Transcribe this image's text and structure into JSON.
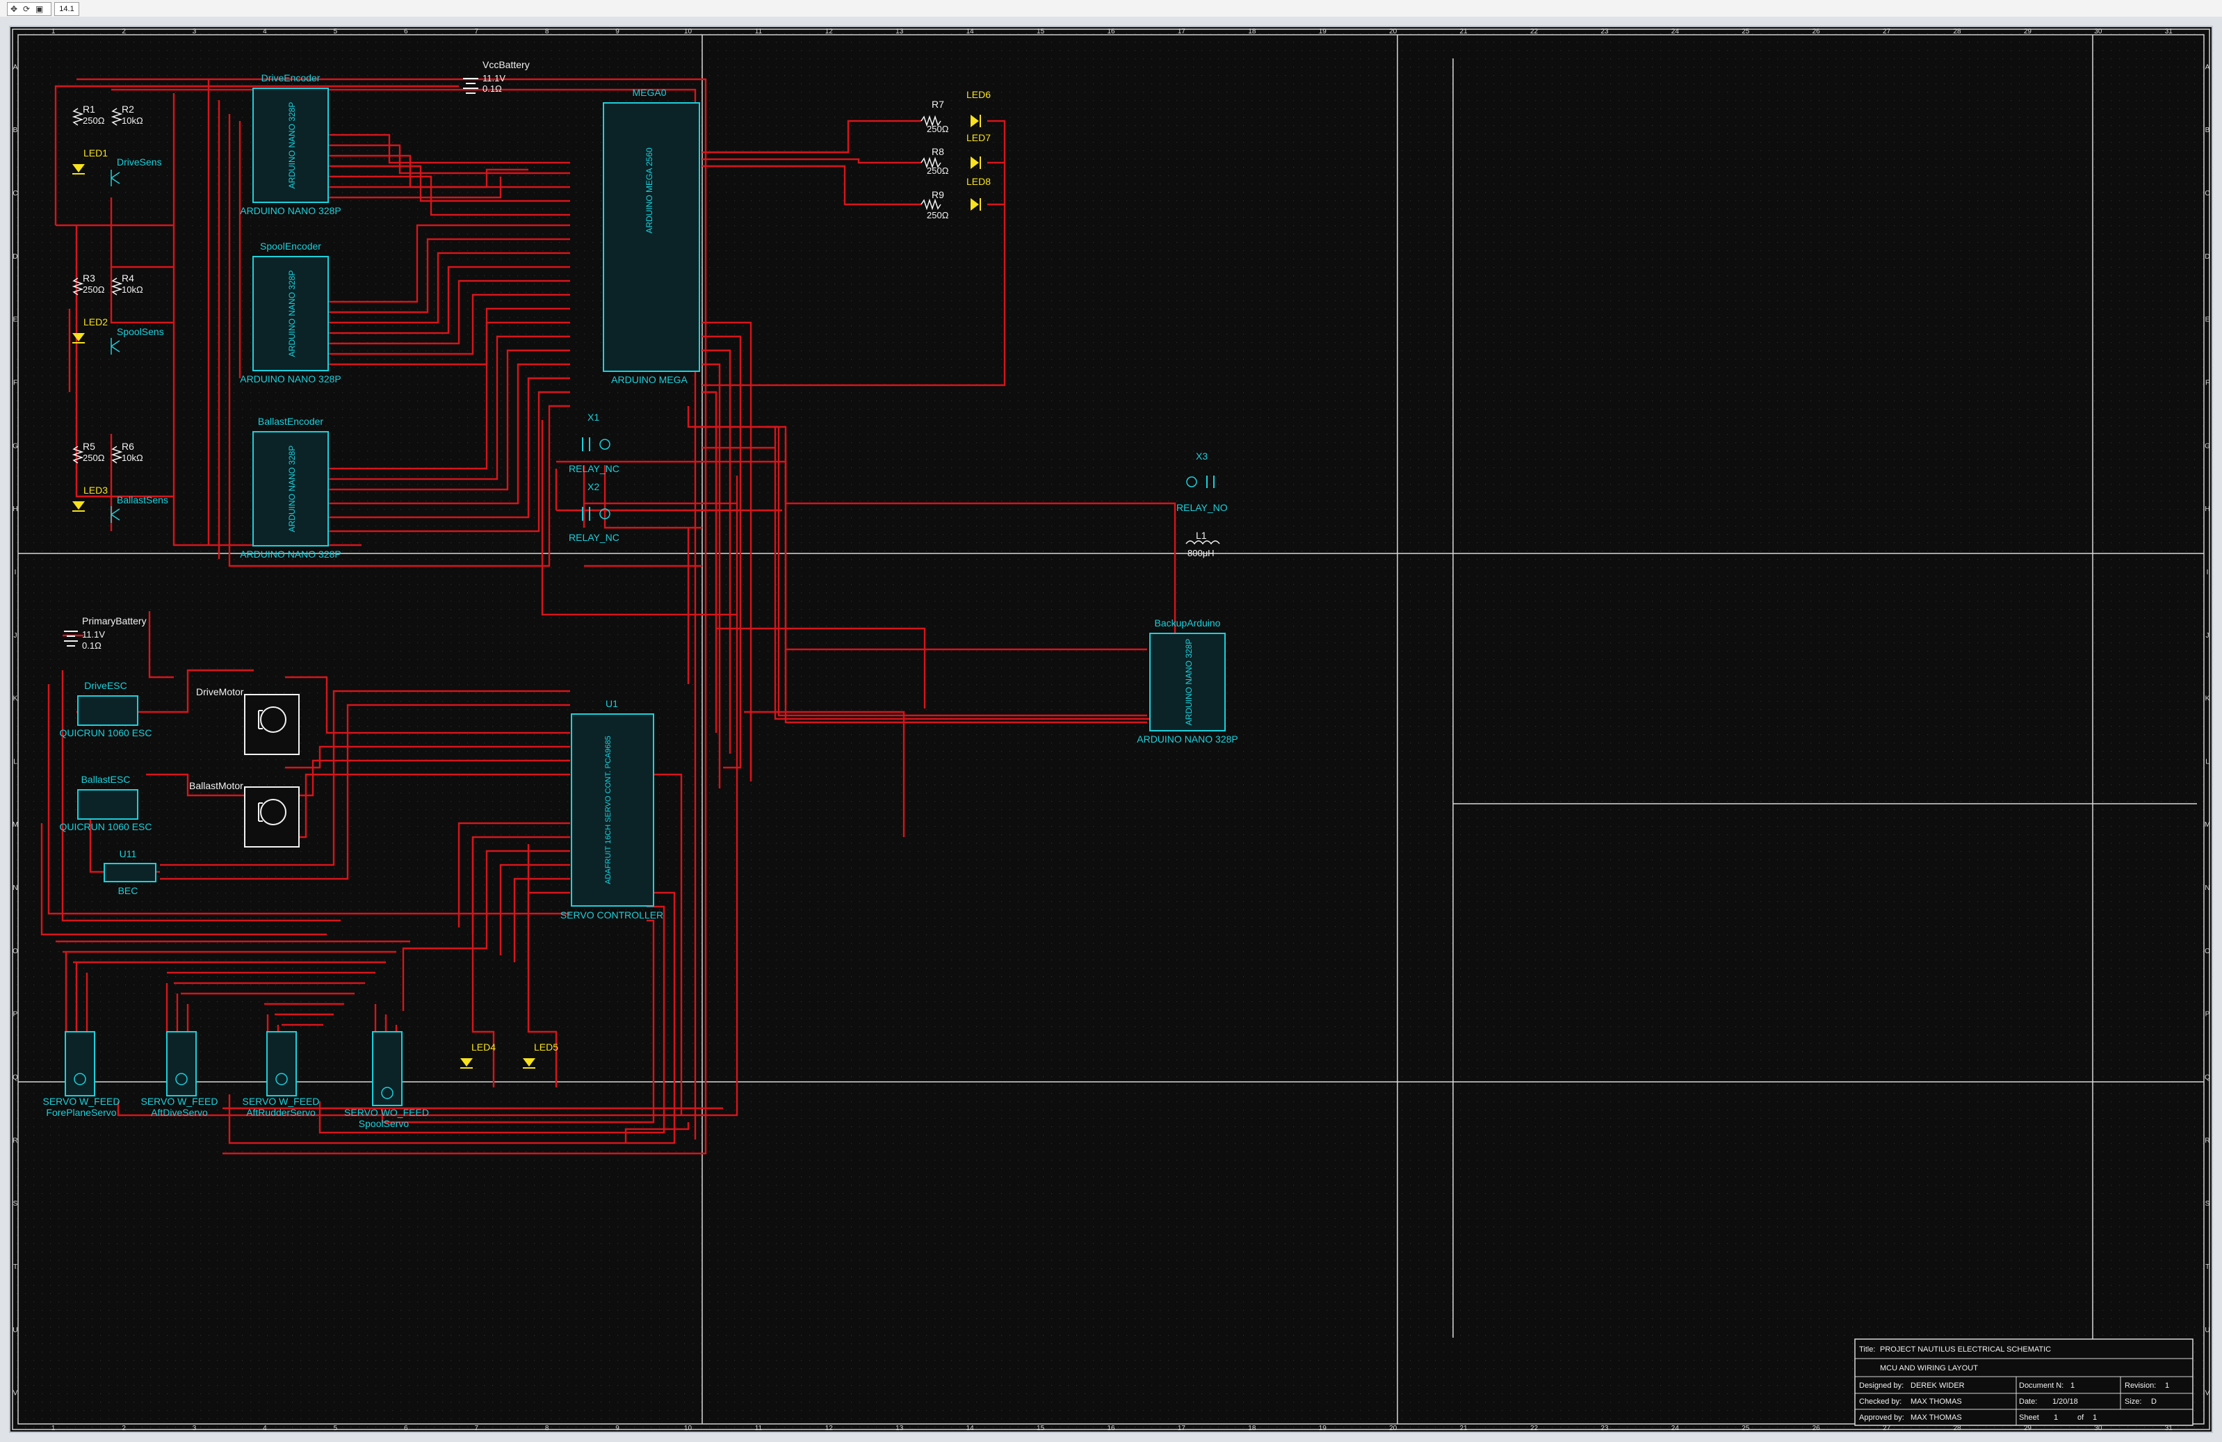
{
  "toolbar": {
    "icons": [
      "pointer-icon",
      "rotate-icon",
      "save-icon"
    ],
    "zoom": "14.1"
  },
  "ruler": {
    "columns": [
      "1",
      "2",
      "3",
      "4",
      "5",
      "6",
      "7",
      "8",
      "9",
      "10",
      "11",
      "12",
      "13",
      "14",
      "15",
      "16",
      "17",
      "18",
      "19",
      "20",
      "21",
      "22",
      "23",
      "24",
      "25",
      "26",
      "27",
      "28",
      "29",
      "30",
      "31"
    ],
    "rows": [
      "A",
      "B",
      "C",
      "D",
      "E",
      "F",
      "G",
      "H",
      "I",
      "J",
      "K",
      "L",
      "M",
      "N",
      "O",
      "P",
      "Q",
      "R",
      "S",
      "T",
      "U",
      "V"
    ]
  },
  "colors": {
    "background": "#0d0d0d",
    "wire": "#d8151b",
    "component": "#19d2dd",
    "label": "#f2f2f2",
    "led": "#f7e21c",
    "border": "#cfcfcf"
  },
  "components": {
    "r1": {
      "ref": "R1",
      "value": "250Ω"
    },
    "r2": {
      "ref": "R2",
      "value": "10kΩ"
    },
    "r3": {
      "ref": "R3",
      "value": "250Ω"
    },
    "r4": {
      "ref": "R4",
      "value": "10kΩ"
    },
    "r5": {
      "ref": "R5",
      "value": "250Ω"
    },
    "r6": {
      "ref": "R6",
      "value": "10kΩ"
    },
    "r7": {
      "ref": "R7",
      "value": "250Ω"
    },
    "r8": {
      "ref": "R8",
      "value": "250Ω"
    },
    "r9": {
      "ref": "R9",
      "value": "250Ω"
    },
    "led1": "LED1",
    "led2": "LED2",
    "led3": "LED3",
    "led4": "LED4",
    "led5": "LED5",
    "led6": "LED6",
    "led7": "LED7",
    "led8": "LED8",
    "drive_sens": "DriveSens",
    "spool_sens": "SpoolSens",
    "ballast_sens": "BallastSens",
    "drive_encoder": {
      "name": "DriveEncoder",
      "part": "ARDUINO NANO 328P"
    },
    "spool_encoder": {
      "name": "SpoolEncoder",
      "part": "ARDUINO NANO 328P"
    },
    "ballast_encoder": {
      "name": "BallastEncoder",
      "part": "ARDUINO NANO 328P"
    },
    "backup_arduino": {
      "name": "BackupArduino",
      "part": "ARDUINO NANO 328P"
    },
    "nano_body": "ARDUINO NANO 328P",
    "mega": {
      "name": "MEGA0",
      "part": "ARDUINO MEGA",
      "body": "ARDUINO MEGA 2560"
    },
    "vcc_battery": {
      "name": "VccBattery",
      "voltage": "11.1V",
      "resistance": "0.1Ω"
    },
    "primary_battery": {
      "name": "PrimaryBattery",
      "voltage": "11.1V",
      "resistance": "0.1Ω"
    },
    "x1": {
      "ref": "X1",
      "part": "RELAY_NC"
    },
    "x2": {
      "ref": "X2",
      "part": "RELAY_NC"
    },
    "x3": {
      "ref": "X3",
      "part": "RELAY_NO"
    },
    "l1": {
      "ref": "L1",
      "value": "800μH"
    },
    "drive_esc": {
      "name": "DriveESC",
      "part": "QUICRUN 1060 ESC"
    },
    "ballast_esc": {
      "name": "BallastESC",
      "part": "QUICRUN 1060 ESC"
    },
    "drive_motor": "DriveMotor",
    "ballast_motor": "BallastMotor",
    "u11": {
      "ref": "U11",
      "part": "BEC"
    },
    "u1": {
      "ref": "U1",
      "part": "SERVO CONTROLLER",
      "body": "ADAFRUIT 16CH SERVO CONT. PCA9685"
    },
    "servos": [
      {
        "part": "SERVO W_FEED",
        "name": "ForePlaneServo"
      },
      {
        "part": "SERVO W_FEED",
        "name": "AftDiveServo"
      },
      {
        "part": "SERVO W_FEED",
        "name": "AftRudderServo"
      },
      {
        "part": "SERVO WO_FEED",
        "name": "SpoolServo"
      }
    ]
  },
  "title_block": {
    "title_label": "Title:",
    "title": "PROJECT NAUTILUS ELECTRICAL SCHEMATIC",
    "subtitle": "MCU AND WIRING LAYOUT",
    "designed_label": "Designed by:",
    "designed": "DEREK WIDER",
    "document_label": "Document N:",
    "document": "1",
    "revision_label": "Revision:",
    "revision": "1",
    "checked_label": "Checked by:",
    "checked": "MAX THOMAS",
    "date_label": "Date:",
    "date": "1/20/18",
    "size_label": "Size:",
    "size": "D",
    "approved_label": "Approved by:",
    "approved": "MAX THOMAS",
    "sheet_label": "Sheet",
    "sheet": "1",
    "of_label": "of",
    "of": "1"
  }
}
